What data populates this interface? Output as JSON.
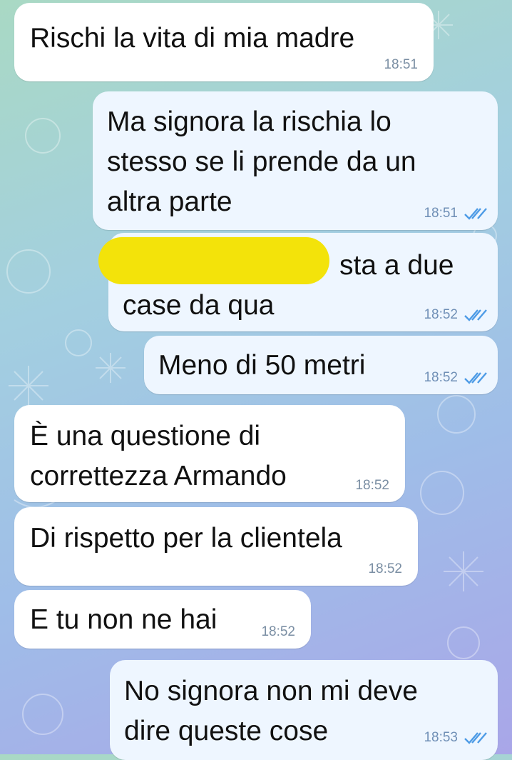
{
  "messages": [
    {
      "text": "Rischi la vita di mia madre",
      "time": "18:51"
    },
    {
      "text": "Ma signora la rischia lo\nstesso se li prende da un\naltra parte",
      "time": "18:51"
    },
    {
      "text": "sta a due\ncase da qua",
      "time": "18:52"
    },
    {
      "text": "Meno di 50 metri",
      "time": "18:52"
    },
    {
      "text": "È una questione di\ncorrettezza Armando",
      "time": "18:52"
    },
    {
      "text": "Di rispetto per la clientela",
      "time": "18:52"
    },
    {
      "text": "E tu non ne hai",
      "time": "18:52"
    },
    {
      "text": "No signora non mi deve\ndire queste cose",
      "time": "18:53"
    }
  ],
  "colors": {
    "incoming_bubble": "#ffffff",
    "outgoing_bubble": "#eef6ff",
    "read_ticks": "#4d9be6",
    "redaction": "#f3e30a"
  }
}
